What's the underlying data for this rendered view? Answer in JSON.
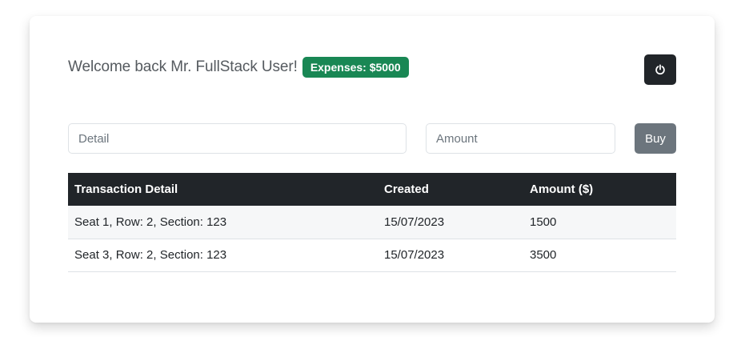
{
  "header": {
    "welcome_text": "Welcome back Mr. FullStack User!",
    "expenses_badge": "Expenses: $5000",
    "logout_icon": "power-icon"
  },
  "form": {
    "detail_placeholder": "Detail",
    "detail_value": "",
    "amount_placeholder": "Amount",
    "amount_value": "",
    "buy_label": "Buy"
  },
  "table": {
    "columns": [
      "Transaction Detail",
      "Created",
      "Amount ($)"
    ],
    "rows": [
      [
        "Seat 1, Row: 2, Section: 123",
        "15/07/2023",
        "1500"
      ],
      [
        "Seat 3, Row: 2, Section: 123",
        "15/07/2023",
        "3500"
      ]
    ]
  },
  "colors": {
    "badge": "#198754",
    "dark": "#212529",
    "buy_button": "#6c757d"
  }
}
